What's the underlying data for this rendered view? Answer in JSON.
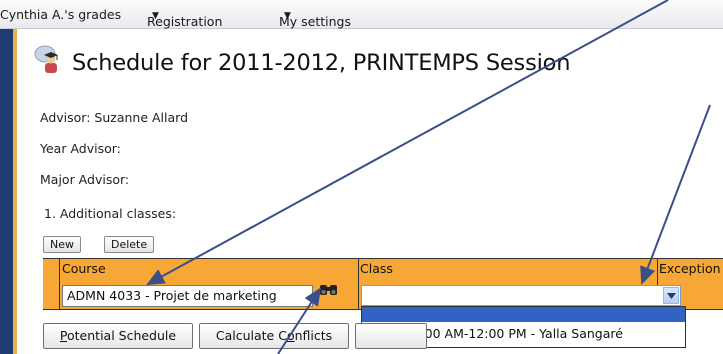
{
  "menubar": {
    "items": [
      {
        "label": "Cynthia A.'s grades",
        "has_menu": false
      },
      {
        "label": "Registration",
        "has_menu": true
      },
      {
        "label": "My settings",
        "has_menu": true
      }
    ],
    "caret": "▼"
  },
  "page": {
    "title": "Schedule for 2011-2012, PRINTEMPS Session",
    "title_icon": "graduate-avatar-icon"
  },
  "advisors": {
    "advisor": "Advisor: Suzanne Allard",
    "year_advisor": "Year Advisor:",
    "major_advisor": "Major Advisor:"
  },
  "section": {
    "heading": "1. Additional classes:"
  },
  "toolbar": {
    "new_label": "New",
    "delete_label": "Delete"
  },
  "grid": {
    "columns": [
      "Course",
      "Class",
      "Exception"
    ],
    "row": {
      "course_value": "ADMN 4033 - Projet de marketing",
      "class_value": "",
      "search_icon": "binoculars-icon"
    }
  },
  "class_dropdown": {
    "options": [
      {
        "label": "",
        "selected": true
      },
      {
        "label": "YS - MJ 9:00 AM-12:00 PM - Yalla Sangaré",
        "selected": false
      }
    ]
  },
  "actions": {
    "potential_schedule": {
      "accel": "P",
      "rest": "otential Schedule"
    },
    "calculate_conflicts": {
      "before": "Calculate C",
      "accel": "o",
      "rest": "nflicts"
    }
  },
  "colors": {
    "rail": "#1f3b72",
    "grid_header": "#f7a735",
    "selection": "#3162c4",
    "annotation_arrow": "#3a4f8a"
  }
}
